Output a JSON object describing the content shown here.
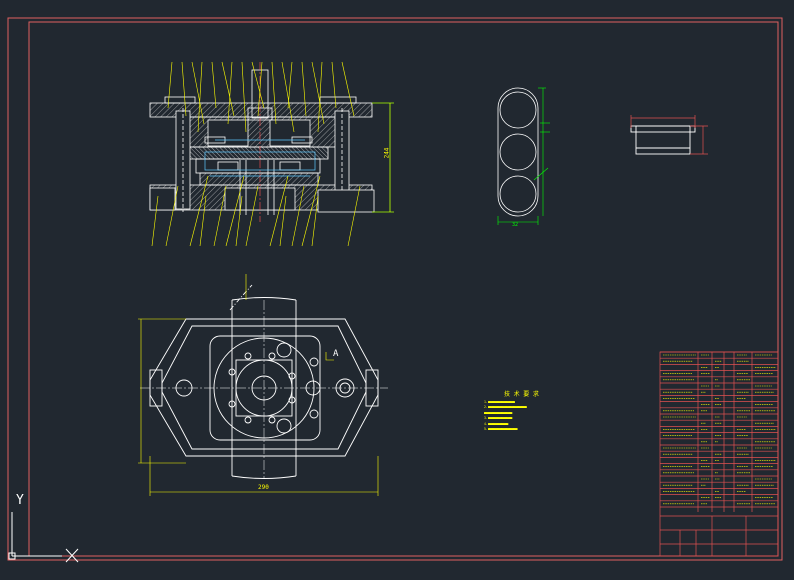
{
  "ucs": {
    "y_label": "Y",
    "x_label": "X"
  },
  "dimensions": {
    "overall_height": "244",
    "plan_width": "290",
    "section_mark": "A",
    "detail_width": "32"
  },
  "technical_requirements": {
    "title": "技 术 要 求",
    "lines": [
      "1. ■■■■■■■■■■■■■■■■■■■■",
      "2. ■■■■■■■■■■■■■■■■■■■■■■■■■■■■■",
      "   ■■■■■■■■■■■■■■■■■■■■■",
      "3. ■■■■■■■■■■■■■■■■■■",
      "4. ■■■■■■■■■■■■■■■",
      "5. ■■■■■■■■■■■■■■■■■■■■■■"
    ]
  },
  "colors": {
    "background": "#212830",
    "frame": "#e06060",
    "outline": "#ffffff",
    "annotation": "#ffff00",
    "dimension": "#00ff00",
    "hidden": "#5cc8ff",
    "section_hatch": "#ffffff",
    "titleblock": "#e05050"
  }
}
